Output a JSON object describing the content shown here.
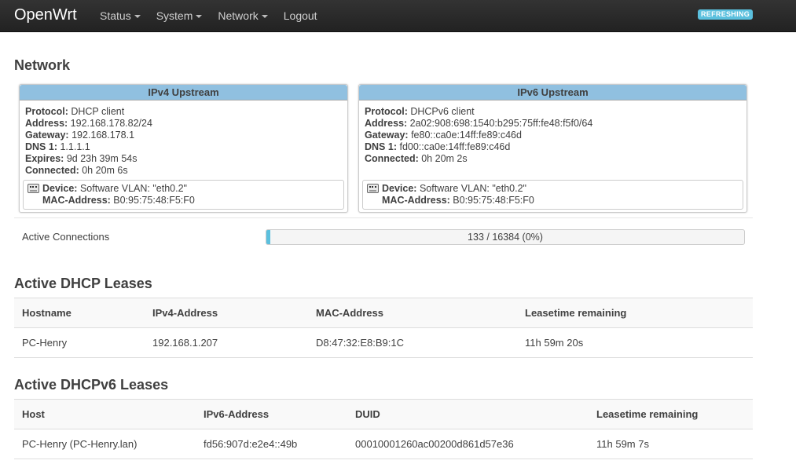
{
  "navbar": {
    "brand": "OpenWrt",
    "menu": [
      "Status",
      "System",
      "Network"
    ],
    "logout": "Logout",
    "badge": "REFRESHING"
  },
  "network": {
    "title": "Network",
    "ipv4": {
      "title": "IPv4 Upstream",
      "fields": [
        {
          "k": "Protocol:",
          "v": "DHCP client"
        },
        {
          "k": "Address:",
          "v": "192.168.178.82/24"
        },
        {
          "k": "Gateway:",
          "v": "192.168.178.1"
        },
        {
          "k": "DNS 1:",
          "v": "1.1.1.1"
        },
        {
          "k": "Expires:",
          "v": "9d 23h 39m 54s"
        },
        {
          "k": "Connected:",
          "v": "0h 20m 6s"
        }
      ],
      "device": {
        "k": "Device:",
        "v": "Software VLAN: \"eth0.2\""
      },
      "mac": {
        "k": "MAC-Address:",
        "v": "B0:95:75:48:F5:F0"
      }
    },
    "ipv6": {
      "title": "IPv6 Upstream",
      "fields": [
        {
          "k": "Protocol:",
          "v": "DHCPv6 client"
        },
        {
          "k": "Address:",
          "v": "2a02:908:698:1540:b295:75ff:fe48:f5f0/64"
        },
        {
          "k": "Gateway:",
          "v": "fe80::ca0e:14ff:fe89:c46d"
        },
        {
          "k": "DNS 1:",
          "v": "fd00::ca0e:14ff:fe89:c46d"
        },
        {
          "k": "Connected:",
          "v": "0h 20m 2s"
        }
      ],
      "device": {
        "k": "Device:",
        "v": "Software VLAN: \"eth0.2\""
      },
      "mac": {
        "k": "MAC-Address:",
        "v": "B0:95:75:48:F5:F0"
      }
    },
    "active_connections": {
      "label": "Active Connections",
      "text": "133 / 16384 (0%)",
      "fraction": 0.008
    }
  },
  "dhcp": {
    "title": "Active DHCP Leases",
    "headers": [
      "Hostname",
      "IPv4-Address",
      "MAC-Address",
      "Leasetime remaining"
    ],
    "rows": [
      [
        "PC-Henry",
        "192.168.1.207",
        "D8:47:32:E8:B9:1C",
        "11h 59m 20s"
      ]
    ]
  },
  "dhcp6": {
    "title": "Active DHCPv6 Leases",
    "headers": [
      "Host",
      "IPv6-Address",
      "DUID",
      "Leasetime remaining"
    ],
    "rows": [
      [
        "PC-Henry (PC-Henry.lan)",
        "fd56:907d:e2e4::49b",
        "00010001260ac00200d861d57e36",
        "11h 59m 7s"
      ]
    ]
  }
}
